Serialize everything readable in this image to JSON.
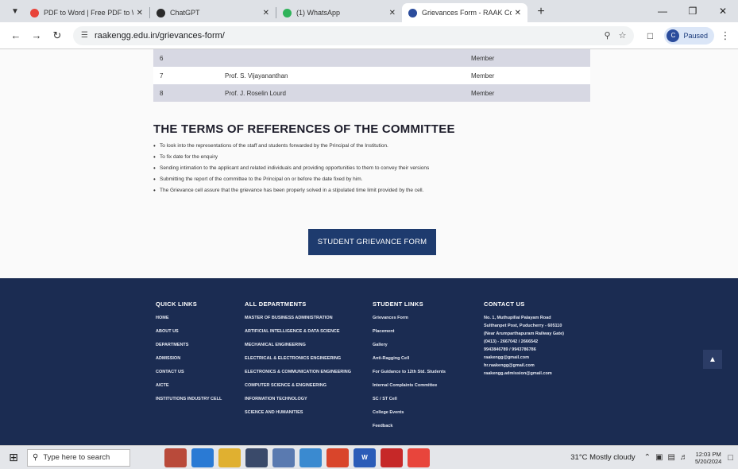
{
  "browser": {
    "tabs": [
      {
        "title": "PDF to Word | Free PDF to Wo",
        "fav_color": "#e8443a",
        "active": false
      },
      {
        "title": "ChatGPT",
        "fav_color": "#2b2b2b",
        "active": false
      },
      {
        "title": "(1) WhatsApp",
        "fav_color": "#2fb35a",
        "active": false
      },
      {
        "title": "Grievances Form - RAAK Colle",
        "fav_color": "#2b4c9c",
        "active": true
      }
    ],
    "url": "raakengg.edu.in/grievances-form/",
    "profile_initial": "C",
    "profile_label": "Paused"
  },
  "table": {
    "rows": [
      {
        "num": "6",
        "name": "",
        "role": "Member",
        "shade": true
      },
      {
        "num": "7",
        "name": "Prof. S. Vijayananthan",
        "role": "Member",
        "shade": false
      },
      {
        "num": "8",
        "name": "Prof. J. Roselin Lourd",
        "role": "Member",
        "shade": true
      }
    ]
  },
  "terms": {
    "heading": "THE TERMS OF REFERENCES OF THE COMMITTEE",
    "items": [
      "To look into the representations of the staff and students forwarded by the Principal of the Institution.",
      "To fix date for the enquiry",
      "Sending intimation to the applicant and related individuals and providing opportunities to them to convey their versions",
      "Submitting the report of the committee to the Principal on or before the date fixed by him.",
      "The Grievance cell assure that the grievance has been properly solved in a stipulated time limit provided by the cell."
    ],
    "button_label": "STUDENT GRIEVANCE FORM"
  },
  "footer": {
    "quick_links": {
      "heading": "QUICK LINKS",
      "items": [
        "HOME",
        "ABOUT US",
        "DEPARTMENTS",
        "ADMISSION",
        "CONTACT US",
        "AICTE",
        "INSTITUTIONS INDUSTRY CELL"
      ]
    },
    "departments": {
      "heading": "ALL DEPARTMENTS",
      "items": [
        "MASTER OF BUSINESS ADMINISTRATION",
        "ARTIFICIAL INTELLIGENCE & DATA SCIENCE",
        "MECHANICAL ENGINEERING",
        "ELECTRICAL & ELECTRONICS ENGINEERING",
        "ELECTRONICS & COMMUNICATION ENGINEERING",
        "COMPUTER SCIENCE & ENGINEERING",
        "INFORMATION TECHNOLOGY",
        "SCIENCE AND HUMANITIES"
      ]
    },
    "student_links": {
      "heading": "STUDENT LINKS",
      "items": [
        "Grievances Form",
        "Placement",
        "Gallery",
        "Anti-Ragging Cell",
        "For Guidance to 12th Std. Students",
        "Internal Complaints Committee",
        "SC / ST Cell",
        "College Events",
        "Feedback"
      ]
    },
    "contact": {
      "heading": "CONTACT US",
      "lines": [
        "No. 1, Muthupillai Palayam Road",
        "Sulthanpet Post, Puducherry - 605110",
        "(Near Arumparthapuram Railway Gate)",
        "(0413) - 2667042 / 2666542",
        "9943846789 / 9943786786",
        "raakengg@gmail.com",
        "hr.raakengg@gmail.com",
        "raakengg.admission@gmail.com"
      ]
    }
  },
  "taskbar": {
    "search_placeholder": "Type here to search",
    "weather": "31°C  Mostly cloudy",
    "time": "12:03 PM",
    "date": "5/20/2024"
  }
}
